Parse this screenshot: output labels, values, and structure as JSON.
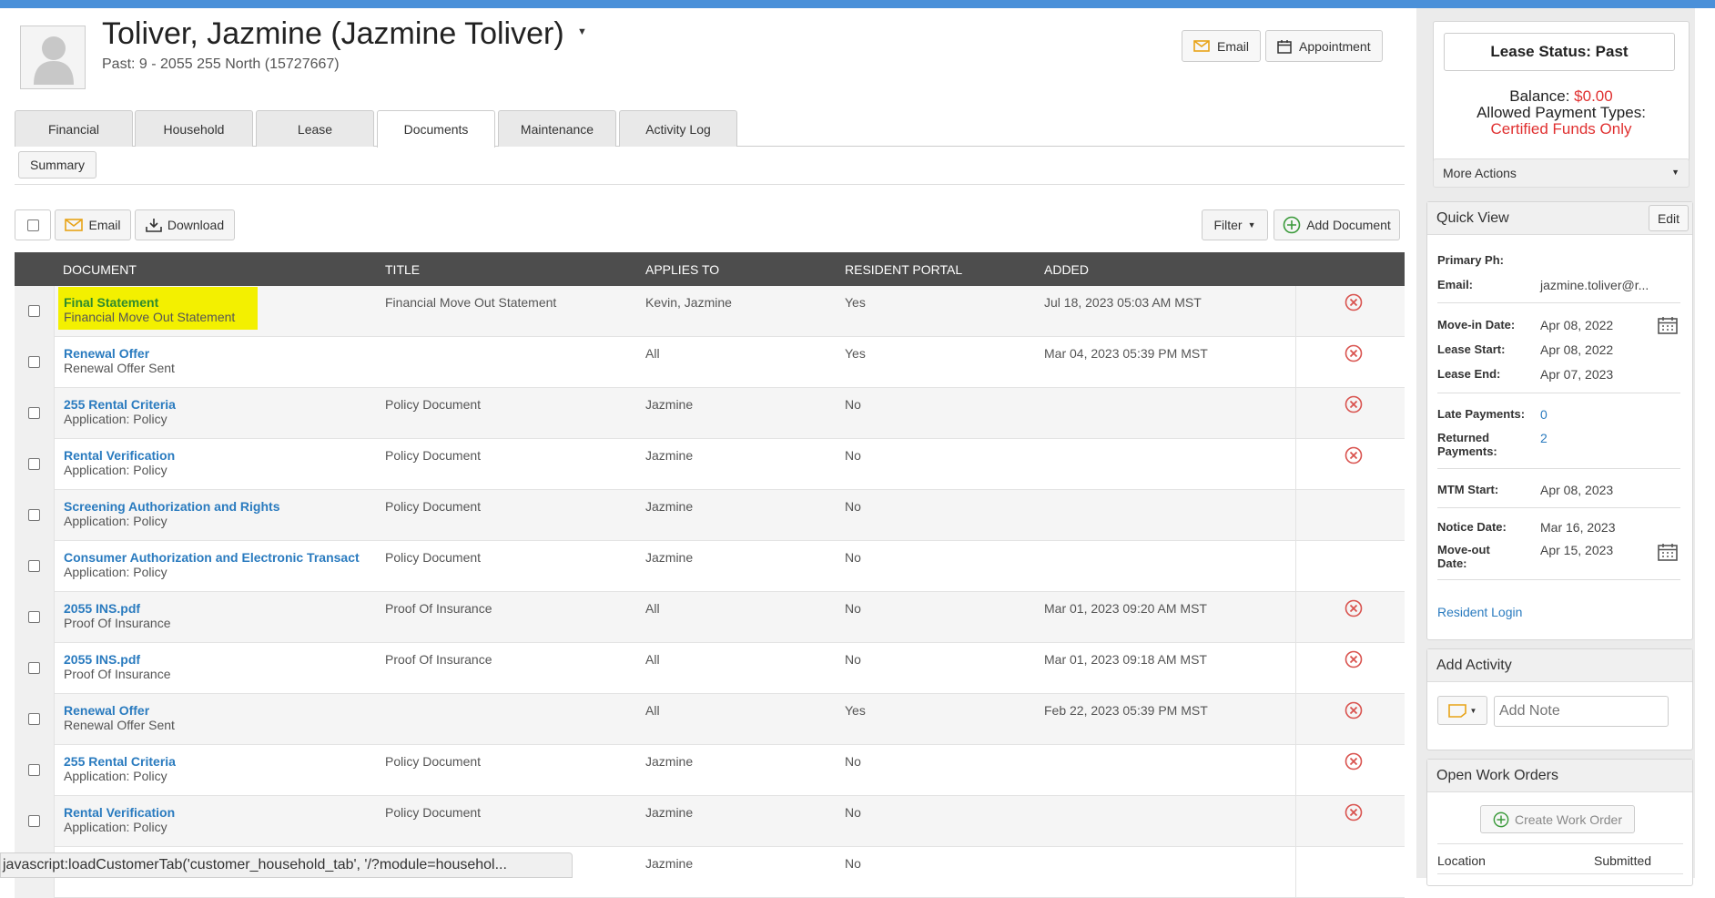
{
  "customer": {
    "name": "Toliver, Jazmine (Jazmine Toliver)",
    "subtitle": "Past: 9 - 2055 255 North (15727667)"
  },
  "header_actions": {
    "email": "Email",
    "appointment": "Appointment"
  },
  "tabs": [
    "Financial",
    "Household",
    "Lease",
    "Documents",
    "Maintenance",
    "Activity Log"
  ],
  "active_tab": "Documents",
  "subnav": {
    "summary": "Summary"
  },
  "toolbar": {
    "email": "Email",
    "download": "Download",
    "filter": "Filter",
    "add_document": "Add Document"
  },
  "table": {
    "columns": [
      "DOCUMENT",
      "TITLE",
      "APPLIES TO",
      "RESIDENT PORTAL",
      "ADDED"
    ],
    "rows": [
      {
        "document": "Final Statement",
        "subtitle": "Financial Move Out Statement",
        "title": "Financial Move Out Statement",
        "applies_to": "Kevin, Jazmine",
        "portal": "Yes",
        "added": "Jul 18, 2023 05:03 AM MST",
        "deletable": true,
        "highlighted": true
      },
      {
        "document": "Renewal Offer",
        "subtitle": "Renewal Offer Sent",
        "title": "",
        "applies_to": "All",
        "portal": "Yes",
        "added": "Mar 04, 2023 05:39 PM MST",
        "deletable": true
      },
      {
        "document": "255 Rental Criteria",
        "subtitle": "Application: Policy",
        "title": "Policy Document",
        "applies_to": "Jazmine",
        "portal": "No",
        "added": "",
        "deletable": true
      },
      {
        "document": "Rental Verification",
        "subtitle": "Application: Policy",
        "title": "Policy Document",
        "applies_to": "Jazmine",
        "portal": "No",
        "added": "",
        "deletable": true
      },
      {
        "document": "Screening Authorization and Rights",
        "subtitle": "Application: Policy",
        "title": "Policy Document",
        "applies_to": "Jazmine",
        "portal": "No",
        "added": "",
        "deletable": false
      },
      {
        "document": "Consumer Authorization and Electronic Transact",
        "subtitle": "Application: Policy",
        "title": "Policy Document",
        "applies_to": "Jazmine",
        "portal": "No",
        "added": "",
        "deletable": false
      },
      {
        "document": "2055 INS.pdf",
        "subtitle": "Proof Of Insurance",
        "title": "Proof Of Insurance",
        "applies_to": "All",
        "portal": "No",
        "added": "Mar 01, 2023 09:20 AM MST",
        "deletable": true
      },
      {
        "document": "2055 INS.pdf",
        "subtitle": "Proof Of Insurance",
        "title": "Proof Of Insurance",
        "applies_to": "All",
        "portal": "No",
        "added": "Mar 01, 2023 09:18 AM MST",
        "deletable": true
      },
      {
        "document": "Renewal Offer",
        "subtitle": "Renewal Offer Sent",
        "title": "",
        "applies_to": "All",
        "portal": "Yes",
        "added": "Feb 22, 2023 05:39 PM MST",
        "deletable": true
      },
      {
        "document": "255 Rental Criteria",
        "subtitle": "Application: Policy",
        "title": "Policy Document",
        "applies_to": "Jazmine",
        "portal": "No",
        "added": "",
        "deletable": true
      },
      {
        "document": "Rental Verification",
        "subtitle": "Application: Policy",
        "title": "Policy Document",
        "applies_to": "Jazmine",
        "portal": "No",
        "added": "",
        "deletable": true
      },
      {
        "document": "",
        "subtitle": "",
        "title": "",
        "applies_to": "Jazmine",
        "portal": "No",
        "added": "",
        "deletable": false
      }
    ]
  },
  "status_bar": "javascript:loadCustomerTab('customer_household_tab', '/?module=househol...",
  "lease_status": {
    "title": "Lease Status: Past",
    "balance_label": "Balance:",
    "balance_value": "$0.00",
    "payment_types_label": "Allowed Payment Types:",
    "payment_types_value": "Certified Funds Only",
    "more_actions": "More Actions"
  },
  "quick_view": {
    "title": "Quick View",
    "edit": "Edit",
    "primary_ph_label": "Primary Ph:",
    "primary_ph_value": "",
    "email_label": "Email:",
    "email_value": "jazmine.toliver@r...",
    "move_in_label": "Move-in Date:",
    "move_in_value": "Apr 08, 2022",
    "lease_start_label": "Lease Start:",
    "lease_start_value": "Apr 08, 2022",
    "lease_end_label": "Lease End:",
    "lease_end_value": "Apr 07, 2023",
    "late_payments_label": "Late Payments:",
    "late_payments_value": "0",
    "returned_payments_label": "Returned Payments:",
    "returned_payments_value": "2",
    "mtm_start_label": "MTM Start:",
    "mtm_start_value": "Apr 08, 2023",
    "notice_date_label": "Notice Date:",
    "notice_date_value": "Mar 16, 2023",
    "move_out_label": "Move-out Date:",
    "move_out_value": "Apr 15, 2023",
    "resident_login": "Resident Login"
  },
  "add_activity": {
    "title": "Add Activity",
    "note_placeholder": "Add Note"
  },
  "work_orders": {
    "title": "Open Work Orders",
    "create": "Create Work Order",
    "col_location": "Location",
    "col_submitted": "Submitted"
  },
  "colors": {
    "link": "#2a7bbf",
    "alert_red": "#e03030",
    "header_bg": "#4d4d4d",
    "highlight": "#f3f000",
    "delete_icon": "#d9534f"
  }
}
